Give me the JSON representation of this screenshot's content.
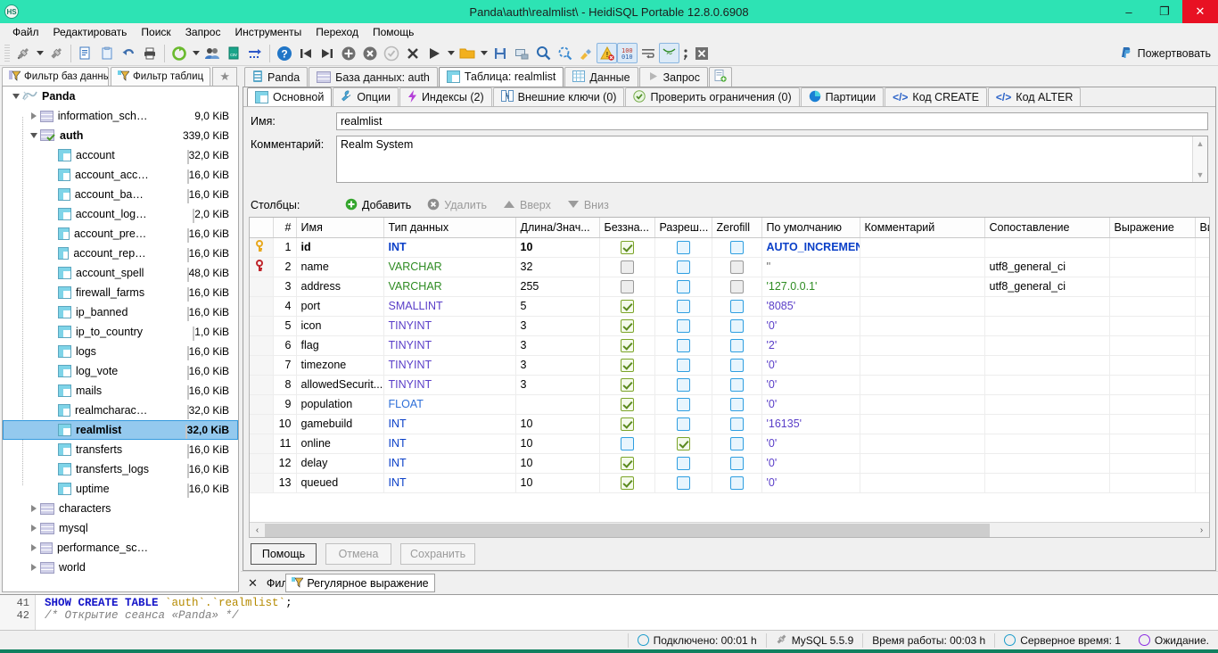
{
  "window": {
    "title": "Panda\\auth\\realmlist\\ - HeidiSQL Portable 12.8.0.6908",
    "app_icon": "heidisql-icon",
    "minimize": "–",
    "maximize": "❐",
    "close": "✕"
  },
  "menu": {
    "items": [
      {
        "label": "Файл"
      },
      {
        "label": "Редактировать"
      },
      {
        "label": "Поиск"
      },
      {
        "label": "Запрос"
      },
      {
        "label": "Инструменты"
      },
      {
        "label": "Переход"
      },
      {
        "label": "Помощь"
      }
    ]
  },
  "toolbar": {
    "donate_label": "Пожертвовать",
    "icons": [
      "connect-icon",
      "connect-dropdown-caret",
      "disconnect-icon",
      "new-query-icon",
      "paste-query-icon",
      "undo-icon",
      "print-icon",
      "refresh-icon",
      "refresh-dropdown-caret",
      "users-icon",
      "export-csv-icon",
      "import-icon",
      "help-icon",
      "first-icon",
      "last-icon",
      "insert-row-icon",
      "delete-row-icon",
      "commit-icon",
      "cancel-icon",
      "run-icon",
      "run-dropdown-caret",
      "open-folder-icon",
      "open-dropdown-caret",
      "save-icon",
      "save-as-icon",
      "find-icon",
      "replace-icon",
      "format-icon",
      "stop-on-error-icon",
      "binary-icon",
      "word-wrap-icon",
      "syntax-highlight-icon",
      "semicolon-icon",
      "close-tab-icon"
    ]
  },
  "sidebar": {
    "tabs": [
      {
        "label": "Фильтр баз данных",
        "icon": "filter-db-icon",
        "active": false
      },
      {
        "label": "Фильтр таблиц",
        "icon": "filter-table-icon",
        "active": true
      }
    ],
    "favorites_icon": "star-icon",
    "tree": [
      {
        "label": "Panda",
        "size": "",
        "indent": 0,
        "expander": "open",
        "icon": "session-icon",
        "bold": true,
        "selected": false,
        "bar": 0
      },
      {
        "label": "information_schema",
        "size": "9,0 KiB",
        "indent": 1,
        "expander": "closed",
        "icon": "database-icon",
        "bold": false,
        "selected": false,
        "bar": 0
      },
      {
        "label": "auth",
        "size": "339,0 KiB",
        "indent": 1,
        "expander": "open",
        "icon": "database-active-icon",
        "bold": true,
        "selected": false,
        "bar": 0
      },
      {
        "label": "account",
        "size": "32,0 KiB",
        "indent": 2,
        "expander": "none",
        "icon": "table-icon",
        "bold": false,
        "selected": false,
        "bar": 56
      },
      {
        "label": "account_access",
        "size": "16,0 KiB",
        "indent": 2,
        "expander": "none",
        "icon": "table-icon",
        "bold": false,
        "selected": false,
        "bar": 28
      },
      {
        "label": "account_banned",
        "size": "16,0 KiB",
        "indent": 2,
        "expander": "none",
        "icon": "table-icon",
        "bold": false,
        "selected": false,
        "bar": 28
      },
      {
        "label": "account_log_ip",
        "size": "2,0 KiB",
        "indent": 2,
        "expander": "none",
        "icon": "table-icon",
        "bold": false,
        "selected": false,
        "bar": 3
      },
      {
        "label": "account_premium",
        "size": "16,0 KiB",
        "indent": 2,
        "expander": "none",
        "icon": "table-icon",
        "bold": false,
        "selected": false,
        "bar": 28
      },
      {
        "label": "account_rep_mods",
        "size": "16,0 KiB",
        "indent": 2,
        "expander": "none",
        "icon": "table-icon",
        "bold": false,
        "selected": false,
        "bar": 28
      },
      {
        "label": "account_spell",
        "size": "48,0 KiB",
        "indent": 2,
        "expander": "none",
        "icon": "table-icon",
        "bold": false,
        "selected": false,
        "bar": 70
      },
      {
        "label": "firewall_farms",
        "size": "16,0 KiB",
        "indent": 2,
        "expander": "none",
        "icon": "table-icon",
        "bold": false,
        "selected": false,
        "bar": 28
      },
      {
        "label": "ip_banned",
        "size": "16,0 KiB",
        "indent": 2,
        "expander": "none",
        "icon": "table-icon",
        "bold": false,
        "selected": false,
        "bar": 28
      },
      {
        "label": "ip_to_country",
        "size": "1,0 KiB",
        "indent": 2,
        "expander": "none",
        "icon": "table-icon",
        "bold": false,
        "selected": false,
        "bar": 2
      },
      {
        "label": "logs",
        "size": "16,0 KiB",
        "indent": 2,
        "expander": "none",
        "icon": "table-icon",
        "bold": false,
        "selected": false,
        "bar": 28
      },
      {
        "label": "log_vote",
        "size": "16,0 KiB",
        "indent": 2,
        "expander": "none",
        "icon": "table-icon",
        "bold": false,
        "selected": false,
        "bar": 28
      },
      {
        "label": "mails",
        "size": "16,0 KiB",
        "indent": 2,
        "expander": "none",
        "icon": "table-icon",
        "bold": false,
        "selected": false,
        "bar": 28
      },
      {
        "label": "realmcharacters",
        "size": "32,0 KiB",
        "indent": 2,
        "expander": "none",
        "icon": "table-icon",
        "bold": false,
        "selected": false,
        "bar": 56
      },
      {
        "label": "realmlist",
        "size": "32,0 KiB",
        "indent": 2,
        "expander": "none",
        "icon": "table-icon",
        "bold": true,
        "selected": true,
        "bar": 56
      },
      {
        "label": "transferts",
        "size": "16,0 KiB",
        "indent": 2,
        "expander": "none",
        "icon": "table-icon",
        "bold": false,
        "selected": false,
        "bar": 28
      },
      {
        "label": "transferts_logs",
        "size": "16,0 KiB",
        "indent": 2,
        "expander": "none",
        "icon": "table-icon",
        "bold": false,
        "selected": false,
        "bar": 28
      },
      {
        "label": "uptime",
        "size": "16,0 KiB",
        "indent": 2,
        "expander": "none",
        "icon": "table-icon",
        "bold": false,
        "selected": false,
        "bar": 28
      },
      {
        "label": "characters",
        "size": "",
        "indent": 1,
        "expander": "closed",
        "icon": "database-icon",
        "bold": false,
        "selected": false,
        "bar": 0
      },
      {
        "label": "mysql",
        "size": "",
        "indent": 1,
        "expander": "closed",
        "icon": "database-icon",
        "bold": false,
        "selected": false,
        "bar": 0
      },
      {
        "label": "performance_schema",
        "size": "",
        "indent": 1,
        "expander": "closed",
        "icon": "database-icon",
        "bold": false,
        "selected": false,
        "bar": 0
      },
      {
        "label": "world",
        "size": "",
        "indent": 1,
        "expander": "closed",
        "icon": "database-icon",
        "bold": false,
        "selected": false,
        "bar": 0
      }
    ]
  },
  "main_tabs": [
    {
      "label": "Panda",
      "icon": "session-icon",
      "active": false
    },
    {
      "label": "База данных: auth",
      "icon": "database-icon",
      "active": false
    },
    {
      "label": "Таблица: realmlist",
      "icon": "table-icon",
      "active": true
    },
    {
      "label": "Данные",
      "icon": "data-grid-icon",
      "active": false
    },
    {
      "label": "Запрос",
      "icon": "play-icon",
      "active": false
    },
    {
      "label": "",
      "icon": "new-query-tab-icon",
      "active": false
    }
  ],
  "sub_tabs": [
    {
      "label": "Основной",
      "icon": "table-icon",
      "active": true
    },
    {
      "label": "Опции",
      "icon": "wrench-icon",
      "active": false
    },
    {
      "label": "Индексы (2)",
      "icon": "lightning-icon",
      "active": false
    },
    {
      "label": "Внешние ключи (0)",
      "icon": "foreign-key-icon",
      "active": false
    },
    {
      "label": "Проверить ограничения (0)",
      "icon": "check-circle-icon",
      "active": false
    },
    {
      "label": "Партиции",
      "icon": "pie-chart-icon",
      "active": false
    },
    {
      "label": "Код CREATE",
      "icon": "code-icon",
      "active": false
    },
    {
      "label": "Код ALTER",
      "icon": "code-icon",
      "active": false
    }
  ],
  "form": {
    "name_label": "Имя:",
    "name_value": "realmlist",
    "comment_label": "Комментарий:",
    "comment_value": "Realm System"
  },
  "columns_toolbar": {
    "label": "Столбцы:",
    "add": "Добавить",
    "remove": "Удалить",
    "up": "Вверх",
    "down": "Вниз"
  },
  "grid": {
    "headers": [
      "",
      "#",
      "Имя",
      "Тип данных",
      "Длина/Знач...",
      "Беззна...",
      "Разреш...",
      "Zerofill",
      "По умолчанию",
      "Комментарий",
      "Сопоставление",
      "Выражение",
      "Ви"
    ],
    "rows": [
      {
        "key": "primary",
        "num": "1",
        "name": "id",
        "type": "INT",
        "type_color": "#0b40c8",
        "len": "10",
        "unsigned": "on",
        "nullable": "off",
        "zerofill": "off",
        "default": "AUTO_INCREMENT",
        "default_color": "#0b40c8",
        "default_bold": true,
        "comment": "",
        "collation": "",
        "expression": "",
        "bold": true
      },
      {
        "key": "index",
        "num": "2",
        "name": "name",
        "type": "VARCHAR",
        "type_color": "#2e8b22",
        "len": "32",
        "unsigned": "dis",
        "nullable": "off",
        "zerofill": "dis",
        "default": "''",
        "default_color": "#666666",
        "default_bold": false,
        "comment": "",
        "collation": "utf8_general_ci",
        "expression": "",
        "bold": false
      },
      {
        "key": "",
        "num": "3",
        "name": "address",
        "type": "VARCHAR",
        "type_color": "#2e8b22",
        "len": "255",
        "unsigned": "dis",
        "nullable": "off",
        "zerofill": "dis",
        "default": "'127.0.0.1'",
        "default_color": "#2e8b22",
        "default_bold": false,
        "comment": "",
        "collation": "utf8_general_ci",
        "expression": "",
        "bold": false
      },
      {
        "key": "",
        "num": "4",
        "name": "port",
        "type": "SMALLINT",
        "type_color": "#5a3ec8",
        "len": "5",
        "unsigned": "on",
        "nullable": "off",
        "zerofill": "off",
        "default": "'8085'",
        "default_color": "#5a3ec8",
        "default_bold": false,
        "comment": "",
        "collation": "",
        "expression": "",
        "bold": false
      },
      {
        "key": "",
        "num": "5",
        "name": "icon",
        "type": "TINYINT",
        "type_color": "#5a3ec8",
        "len": "3",
        "unsigned": "on",
        "nullable": "off",
        "zerofill": "off",
        "default": "'0'",
        "default_color": "#5a3ec8",
        "default_bold": false,
        "comment": "",
        "collation": "",
        "expression": "",
        "bold": false
      },
      {
        "key": "",
        "num": "6",
        "name": "flag",
        "type": "TINYINT",
        "type_color": "#5a3ec8",
        "len": "3",
        "unsigned": "on",
        "nullable": "off",
        "zerofill": "off",
        "default": "'2'",
        "default_color": "#5a3ec8",
        "default_bold": false,
        "comment": "",
        "collation": "",
        "expression": "",
        "bold": false
      },
      {
        "key": "",
        "num": "7",
        "name": "timezone",
        "type": "TINYINT",
        "type_color": "#5a3ec8",
        "len": "3",
        "unsigned": "on",
        "nullable": "off",
        "zerofill": "off",
        "default": "'0'",
        "default_color": "#5a3ec8",
        "default_bold": false,
        "comment": "",
        "collation": "",
        "expression": "",
        "bold": false
      },
      {
        "key": "",
        "num": "8",
        "name": "allowedSecurit...",
        "type": "TINYINT",
        "type_color": "#5a3ec8",
        "len": "3",
        "unsigned": "on",
        "nullable": "off",
        "zerofill": "off",
        "default": "'0'",
        "default_color": "#5a3ec8",
        "default_bold": false,
        "comment": "",
        "collation": "",
        "expression": "",
        "bold": false
      },
      {
        "key": "",
        "num": "9",
        "name": "population",
        "type": "FLOAT",
        "type_color": "#2e6fd8",
        "len": "",
        "unsigned": "on",
        "nullable": "off",
        "zerofill": "off",
        "default": "'0'",
        "default_color": "#5a3ec8",
        "default_bold": false,
        "comment": "",
        "collation": "",
        "expression": "",
        "bold": false
      },
      {
        "key": "",
        "num": "10",
        "name": "gamebuild",
        "type": "INT",
        "type_color": "#0b40c8",
        "len": "10",
        "unsigned": "on",
        "nullable": "off",
        "zerofill": "off",
        "default": "'16135'",
        "default_color": "#5a3ec8",
        "default_bold": false,
        "comment": "",
        "collation": "",
        "expression": "",
        "bold": false
      },
      {
        "key": "",
        "num": "11",
        "name": "online",
        "type": "INT",
        "type_color": "#0b40c8",
        "len": "10",
        "unsigned": "off",
        "nullable": "on",
        "zerofill": "off",
        "default": "'0'",
        "default_color": "#5a3ec8",
        "default_bold": false,
        "comment": "",
        "collation": "",
        "expression": "",
        "bold": false
      },
      {
        "key": "",
        "num": "12",
        "name": "delay",
        "type": "INT",
        "type_color": "#0b40c8",
        "len": "10",
        "unsigned": "on",
        "nullable": "off",
        "zerofill": "off",
        "default": "'0'",
        "default_color": "#5a3ec8",
        "default_bold": false,
        "comment": "",
        "collation": "",
        "expression": "",
        "bold": false
      },
      {
        "key": "",
        "num": "13",
        "name": "queued",
        "type": "INT",
        "type_color": "#0b40c8",
        "len": "10",
        "unsigned": "on",
        "nullable": "off",
        "zerofill": "off",
        "default": "'0'",
        "default_color": "#5a3ec8",
        "default_bold": false,
        "comment": "",
        "collation": "",
        "expression": "",
        "bold": false
      }
    ]
  },
  "buttons": {
    "help": "Помощь",
    "cancel": "Отмена",
    "save": "Сохранить"
  },
  "filter": {
    "close_icon": "close-icon",
    "label": "Фильтр:",
    "regex_label": "Регулярное выражение",
    "regex_icon": "filter-table-icon"
  },
  "sql_log": {
    "lines": [
      {
        "no": "41",
        "kw1": "SHOW CREATE TABLE",
        "ident": " `auth`.`realmlist`",
        "tail": ";",
        "comment": ""
      },
      {
        "no": "42",
        "kw1": "",
        "ident": "",
        "tail": "",
        "comment": "/* Открытие сеанса «Panda» */"
      }
    ]
  },
  "statusbar": {
    "connected": "Подключено: 00:01 h",
    "server": "MySQL 5.5.9",
    "uptime": "Время работы: 00:03 h",
    "servertime": "Серверное время: 1",
    "state": "Ожидание."
  },
  "colors": {
    "title_bar": "#2de3b4",
    "close_button": "#e81123",
    "selection": "#94c9ee",
    "accent_green": "#108060"
  }
}
